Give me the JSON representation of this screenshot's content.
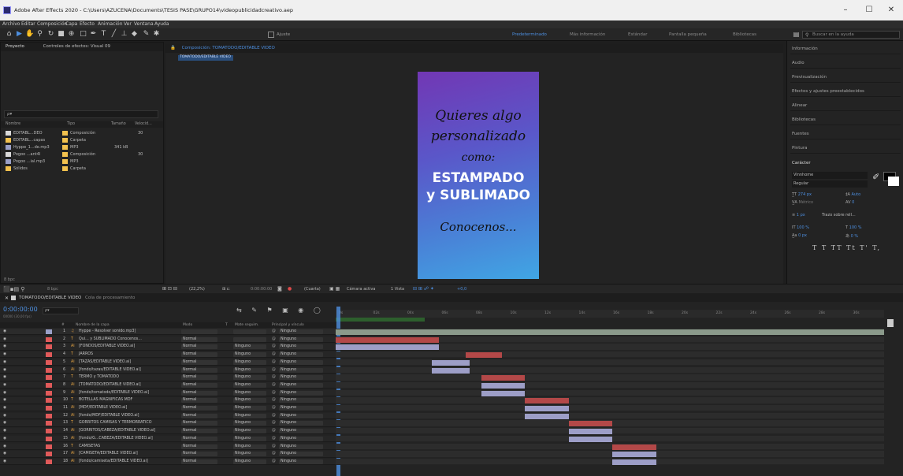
{
  "window": {
    "title": "Adobe After Effects 2020 - C:\\Users\\AZUCENA\\Documents\\TESIS PASE\\GRUPO14\\videopublicidadcreativo.aep",
    "minimize": "–",
    "maximize": "☐",
    "close": "✕"
  },
  "menu": [
    "Archivo",
    "Editar",
    "Composición",
    "Capa",
    "Efecto",
    "Animación",
    "Ver",
    "Ventana",
    "Ayuda"
  ],
  "toolbar": {
    "tool_icons": [
      "home-icon",
      "selection-icon",
      "hand-icon",
      "zoom-icon",
      "rotate-icon",
      "camera-icon",
      "pan-behind-icon",
      "rectangle-icon",
      "pen-icon",
      "type-icon",
      "brush-icon",
      "clone-icon",
      "eraser-icon",
      "roto-brush-icon",
      "puppet-icon"
    ],
    "adjust_label": "Ajuste",
    "workspaces": [
      "Predeterminado",
      "Más información",
      "Estándar",
      "Pantalla pequeña",
      "Bibliotecas"
    ],
    "active_workspace": "Predeterminado",
    "search_placeholder": "Buscar en la ayuda"
  },
  "project_panel": {
    "tab": "Proyecto",
    "tab2": "Controles de efectos: Visual 09",
    "search_placeholder": "ρ▾",
    "columns": [
      "Nombre",
      "Tipo",
      "Tamaño",
      "Velocid..."
    ],
    "items": [
      {
        "name": "EDITABL...DEO",
        "color": "#d9d9d9",
        "type": "Composición",
        "size": "",
        "speed": "30"
      },
      {
        "name": "EDITABL...capas",
        "color": "#f2c14e",
        "type": "Carpeta",
        "size": "",
        "speed": ""
      },
      {
        "name": "Hyppe_1...de.mp3",
        "color": "#9aa0c8",
        "type": "MP3",
        "size": "341 kB",
        "speed": ""
      },
      {
        "name": "Pogoo ...ant4l",
        "color": "#d9d9d9",
        "type": "Composición",
        "size": "",
        "speed": "30"
      },
      {
        "name": "Pogoo ...ial.mp3",
        "color": "#9aa0c8",
        "type": "MP3",
        "size": "",
        "speed": ""
      },
      {
        "name": "Sólidos",
        "color": "#f2c14e",
        "type": "Carpeta",
        "size": "",
        "speed": ""
      }
    ],
    "bottom_label": "8 bpc"
  },
  "composition_panel": {
    "tab": "Composición: TOMATODO/EDITABLE VIDEO",
    "breadcrumb": "TOMATODO/EDITABLE VIDEO",
    "canvas_lines": [
      "Quieres algo",
      "personalizado",
      "como:",
      "ESTAMPADO",
      "y SUBLIMADO",
      "Conocenos..."
    ]
  },
  "viewer_bar": {
    "zoom": "(22,2%)",
    "timecode": "0:00:00:00",
    "quality": "(Cuarta)",
    "camera": "Cámara activa",
    "views": "1 Vista",
    "offset": "+0,0"
  },
  "right_panel": {
    "items": [
      "Información",
      "Audio",
      "Previsualización",
      "Efectos y ajustes preestablecidos",
      "Alinear",
      "Bibliotecas",
      "Fuentes",
      "Pintura"
    ],
    "character": {
      "header": "Carácter",
      "font": "Vinnhome",
      "style": "Regular",
      "size": "274 px",
      "leading": "Auto",
      "kerning": "Métrico",
      "tracking": "0",
      "stroke": "1 px",
      "stroke_type": "Trazo sobre rell...",
      "vscale": "100 %",
      "hscale": "100 %",
      "baseline": "0 px",
      "tsume": "0 %",
      "styles": "T T TT Tt T' T,"
    }
  },
  "timeline": {
    "tab": "TOMATODO/EDITABLE VIDEO",
    "tab2": "Cola de procesamiento",
    "timecode": "0:00:00:00",
    "timecode_sub": "00000 (30,00 fps)",
    "columns": [
      "#",
      "Nombre de la capa",
      "Modo",
      "T",
      "Mate seguim.",
      "Principal y vínculo"
    ],
    "ruler": [
      "0s",
      "02s",
      "04s",
      "06s",
      "08s",
      "10s",
      "12s",
      "14s",
      "16s",
      "18s",
      "20s",
      "22s",
      "24s",
      "26s",
      "28s",
      "30s"
    ],
    "layers": [
      {
        "num": "1",
        "color": "#9aa0c8",
        "type": "♫",
        "name": "Hyppe - Resolver sonido.mp3]",
        "mode": "",
        "mate": "",
        "parent": "Ninguno"
      },
      {
        "num": "2",
        "color": "#e05a5a",
        "type": "T",
        "name": "Qui... y SUBLIMADO  Conocenos...",
        "mode": "Normal",
        "mate": "",
        "parent": "Ninguno"
      },
      {
        "num": "3",
        "color": "#e05a5a",
        "type": "Ai",
        "name": "[FONDOS/EDITABLE VIDEO.ai]",
        "mode": "Normal",
        "mate": "Ninguno",
        "parent": "Ninguno"
      },
      {
        "num": "4",
        "color": "#e05a5a",
        "type": "T",
        "name": "JARROS",
        "mode": "Normal",
        "mate": "Ninguno",
        "parent": "Ninguno"
      },
      {
        "num": "5",
        "color": "#e05a5a",
        "type": "Ai",
        "name": "[TAZAS/EDITABLE VIDEO.ai]",
        "mode": "Normal",
        "mate": "Ninguno",
        "parent": "Ninguno"
      },
      {
        "num": "6",
        "color": "#e05a5a",
        "type": "Ai",
        "name": "[fondo/tazas/EDITABLE VIDEO.ai]",
        "mode": "Normal",
        "mate": "Ninguno",
        "parent": "Ninguno"
      },
      {
        "num": "7",
        "color": "#e05a5a",
        "type": "T",
        "name": "TERMO y TOMATODO",
        "mode": "Normal",
        "mate": "Ninguno",
        "parent": "Ninguno"
      },
      {
        "num": "8",
        "color": "#e05a5a",
        "type": "Ai",
        "name": "[TOMATODO/EDITABLE VIDEO.ai]",
        "mode": "Normal",
        "mate": "Ninguno",
        "parent": "Ninguno"
      },
      {
        "num": "9",
        "color": "#e05a5a",
        "type": "Ai",
        "name": "[fondo/tomatodo/EDITABLE VIDEO.ai]",
        "mode": "Normal",
        "mate": "Ninguno",
        "parent": "Ninguno"
      },
      {
        "num": "10",
        "color": "#e05a5a",
        "type": "T",
        "name": "BOTELLAS MAGNIFICAS MDF",
        "mode": "Normal",
        "mate": "Ninguno",
        "parent": "Ninguno"
      },
      {
        "num": "11",
        "color": "#e05a5a",
        "type": "Ai",
        "name": "[MDF/EDITABLE VIDEO.ai]",
        "mode": "Normal",
        "mate": "Ninguno",
        "parent": "Ninguno"
      },
      {
        "num": "12",
        "color": "#e05a5a",
        "type": "Ai",
        "name": "[fondo/MDF/EDITABLE VIDEO.ai]",
        "mode": "Normal",
        "mate": "Ninguno",
        "parent": "Ninguno"
      },
      {
        "num": "13",
        "color": "#e05a5a",
        "type": "T",
        "name": "GORRITOS CAMISAS Y TERMORRATICO",
        "mode": "Normal",
        "mate": "Ninguno",
        "parent": "Ninguno"
      },
      {
        "num": "14",
        "color": "#e05a5a",
        "type": "Ai",
        "name": "[GORRITOS/CABEZA/EDITABLE VIDEO.ai]",
        "mode": "Normal",
        "mate": "Ninguno",
        "parent": "Ninguno"
      },
      {
        "num": "15",
        "color": "#e05a5a",
        "type": "Ai",
        "name": "[fondo/G...CABEZA/EDITABLE VIDEO.ai]",
        "mode": "Normal",
        "mate": "Ninguno",
        "parent": "Ninguno"
      },
      {
        "num": "16",
        "color": "#e05a5a",
        "type": "T",
        "name": "CAMISETAS",
        "mode": "Normal",
        "mate": "Ninguno",
        "parent": "Ninguno"
      },
      {
        "num": "17",
        "color": "#e05a5a",
        "type": "Ai",
        "name": "[CAMISETA/EDITABLE VIDEO.ai]",
        "mode": "Normal",
        "mate": "Ninguno",
        "parent": "Ninguno"
      },
      {
        "num": "18",
        "color": "#e05a5a",
        "type": "Ai",
        "name": "[fondo/camiseta/EDITABLE VIDEO.ai]",
        "mode": "Normal",
        "mate": "Ninguno",
        "parent": "Ninguno"
      }
    ],
    "bars": [
      {
        "start": 0.0,
        "end": 1.0,
        "color": "#8b9a8b"
      },
      {
        "start": 0.0,
        "end": 0.188,
        "color": "#b34848"
      },
      {
        "start": 0.0,
        "end": 0.188,
        "color": "#9d9ec7"
      },
      {
        "start": 0.237,
        "end": 0.303,
        "color": "#b34848"
      },
      {
        "start": 0.176,
        "end": 0.244,
        "color": "#9d9ec7"
      },
      {
        "start": 0.176,
        "end": 0.244,
        "color": "#9d9ec7"
      },
      {
        "start": 0.266,
        "end": 0.345,
        "color": "#b34848"
      },
      {
        "start": 0.266,
        "end": 0.345,
        "color": "#9d9ec7"
      },
      {
        "start": 0.266,
        "end": 0.345,
        "color": "#9d9ec7"
      },
      {
        "start": 0.345,
        "end": 0.425,
        "color": "#b34848"
      },
      {
        "start": 0.345,
        "end": 0.425,
        "color": "#9d9ec7"
      },
      {
        "start": 0.345,
        "end": 0.425,
        "color": "#9d9ec7"
      },
      {
        "start": 0.425,
        "end": 0.505,
        "color": "#b34848"
      },
      {
        "start": 0.425,
        "end": 0.505,
        "color": "#9d9ec7"
      },
      {
        "start": 0.425,
        "end": 0.505,
        "color": "#9d9ec7"
      },
      {
        "start": 0.505,
        "end": 0.585,
        "color": "#b34848"
      },
      {
        "start": 0.505,
        "end": 0.585,
        "color": "#9d9ec7"
      },
      {
        "start": 0.505,
        "end": 0.585,
        "color": "#9d9ec7"
      }
    ],
    "work_area_fraction": 0.163
  }
}
